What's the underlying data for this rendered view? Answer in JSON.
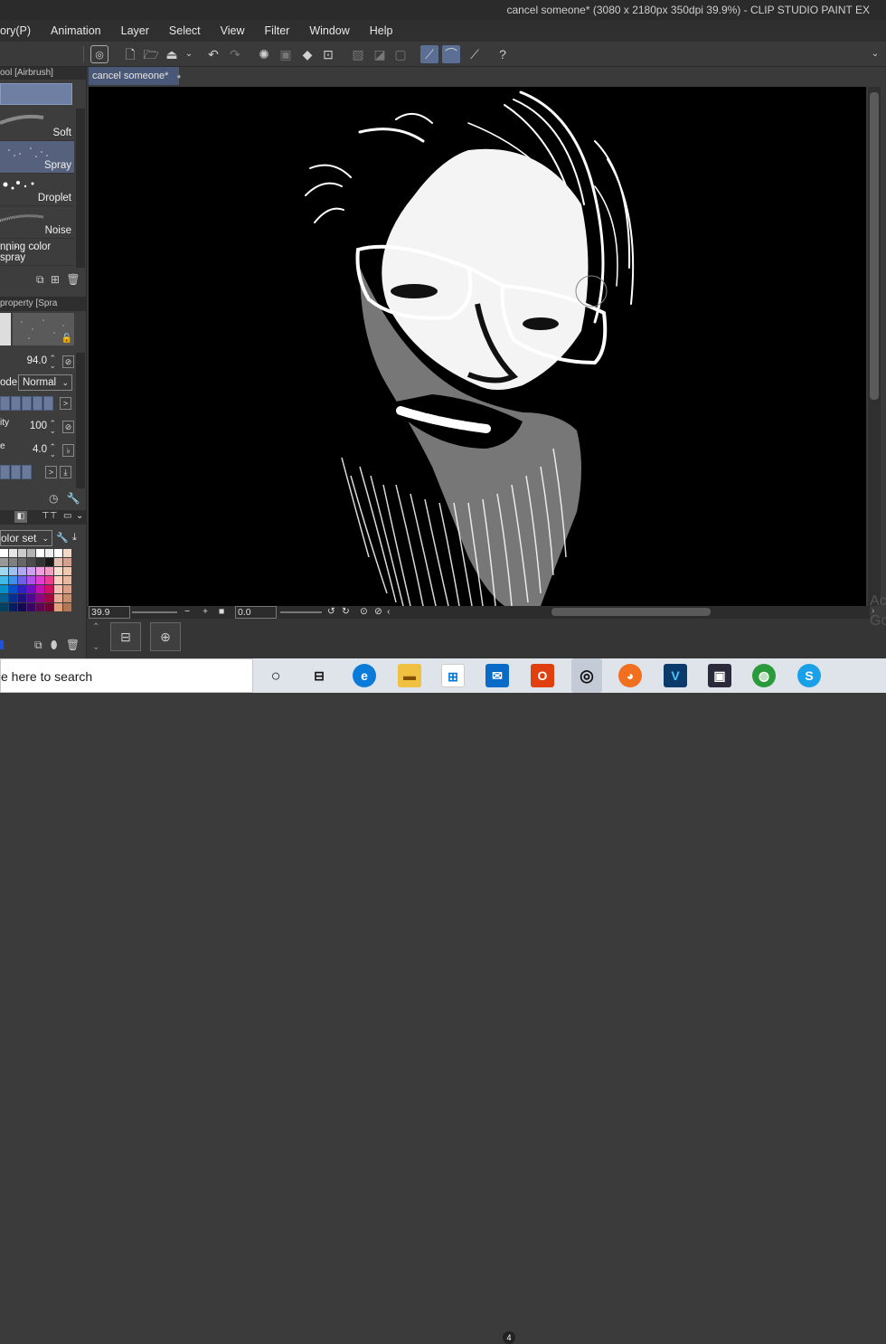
{
  "window": {
    "title": "cancel someone* (3080 x 2180px 350dpi 39.9%)  - CLIP STUDIO PAINT EX"
  },
  "menu": [
    "ory(P)",
    "Animation",
    "Layer",
    "Select",
    "View",
    "Filter",
    "Window",
    "Help"
  ],
  "toolbar": {
    "icons": [
      "clip-studio-icon",
      "new-file-icon",
      "open-folder-icon",
      "save-icon",
      "chevron-down-icon",
      "undo-icon",
      "redo-icon",
      "loading-icon",
      "select-all-icon",
      "fill-icon",
      "transform-icon",
      "clear-icon",
      "fill-selection-icon",
      "snap-icon",
      "ruler-snap-icon",
      "perspective-icon",
      "help-icon"
    ]
  },
  "sub_tool": {
    "tab_label": "ool [Airbrush]",
    "brushes": [
      {
        "label": "Soft"
      },
      {
        "label": "Spray",
        "selected": true
      },
      {
        "label": "Droplet"
      },
      {
        "label": "Noise"
      },
      {
        "label": "nning color spray"
      }
    ]
  },
  "tool_property": {
    "tab_label": "property [Spra",
    "size_value": "94.0",
    "blend_label": "ode",
    "blend_value": "Normal",
    "opacity_label": "ity",
    "opacity_value": "100",
    "density_label": "e",
    "density_value": "4.0"
  },
  "color_set": {
    "label": "olor set"
  },
  "document": {
    "tab_label": "cancel someone*",
    "tab_dot": "●"
  },
  "status": {
    "zoom": "39.9",
    "angle": "0.0"
  },
  "activate_watermark": [
    "Ac",
    "Go"
  ],
  "taskbar": {
    "search_placeholder": "e here to search",
    "mail_badge": "4",
    "apps": [
      "task-view-icon",
      "edge-icon",
      "file-explorer-icon",
      "store-icon",
      "mail-icon",
      "office-icon",
      "clip-studio-icon",
      "firefox-icon",
      "vegas-icon",
      "tiktok-icon",
      "network-icon",
      "skype-icon"
    ]
  },
  "colors": {
    "accent": "#5a6f93",
    "selected_brush": "#56627d",
    "canvas_bg": "#000000"
  }
}
